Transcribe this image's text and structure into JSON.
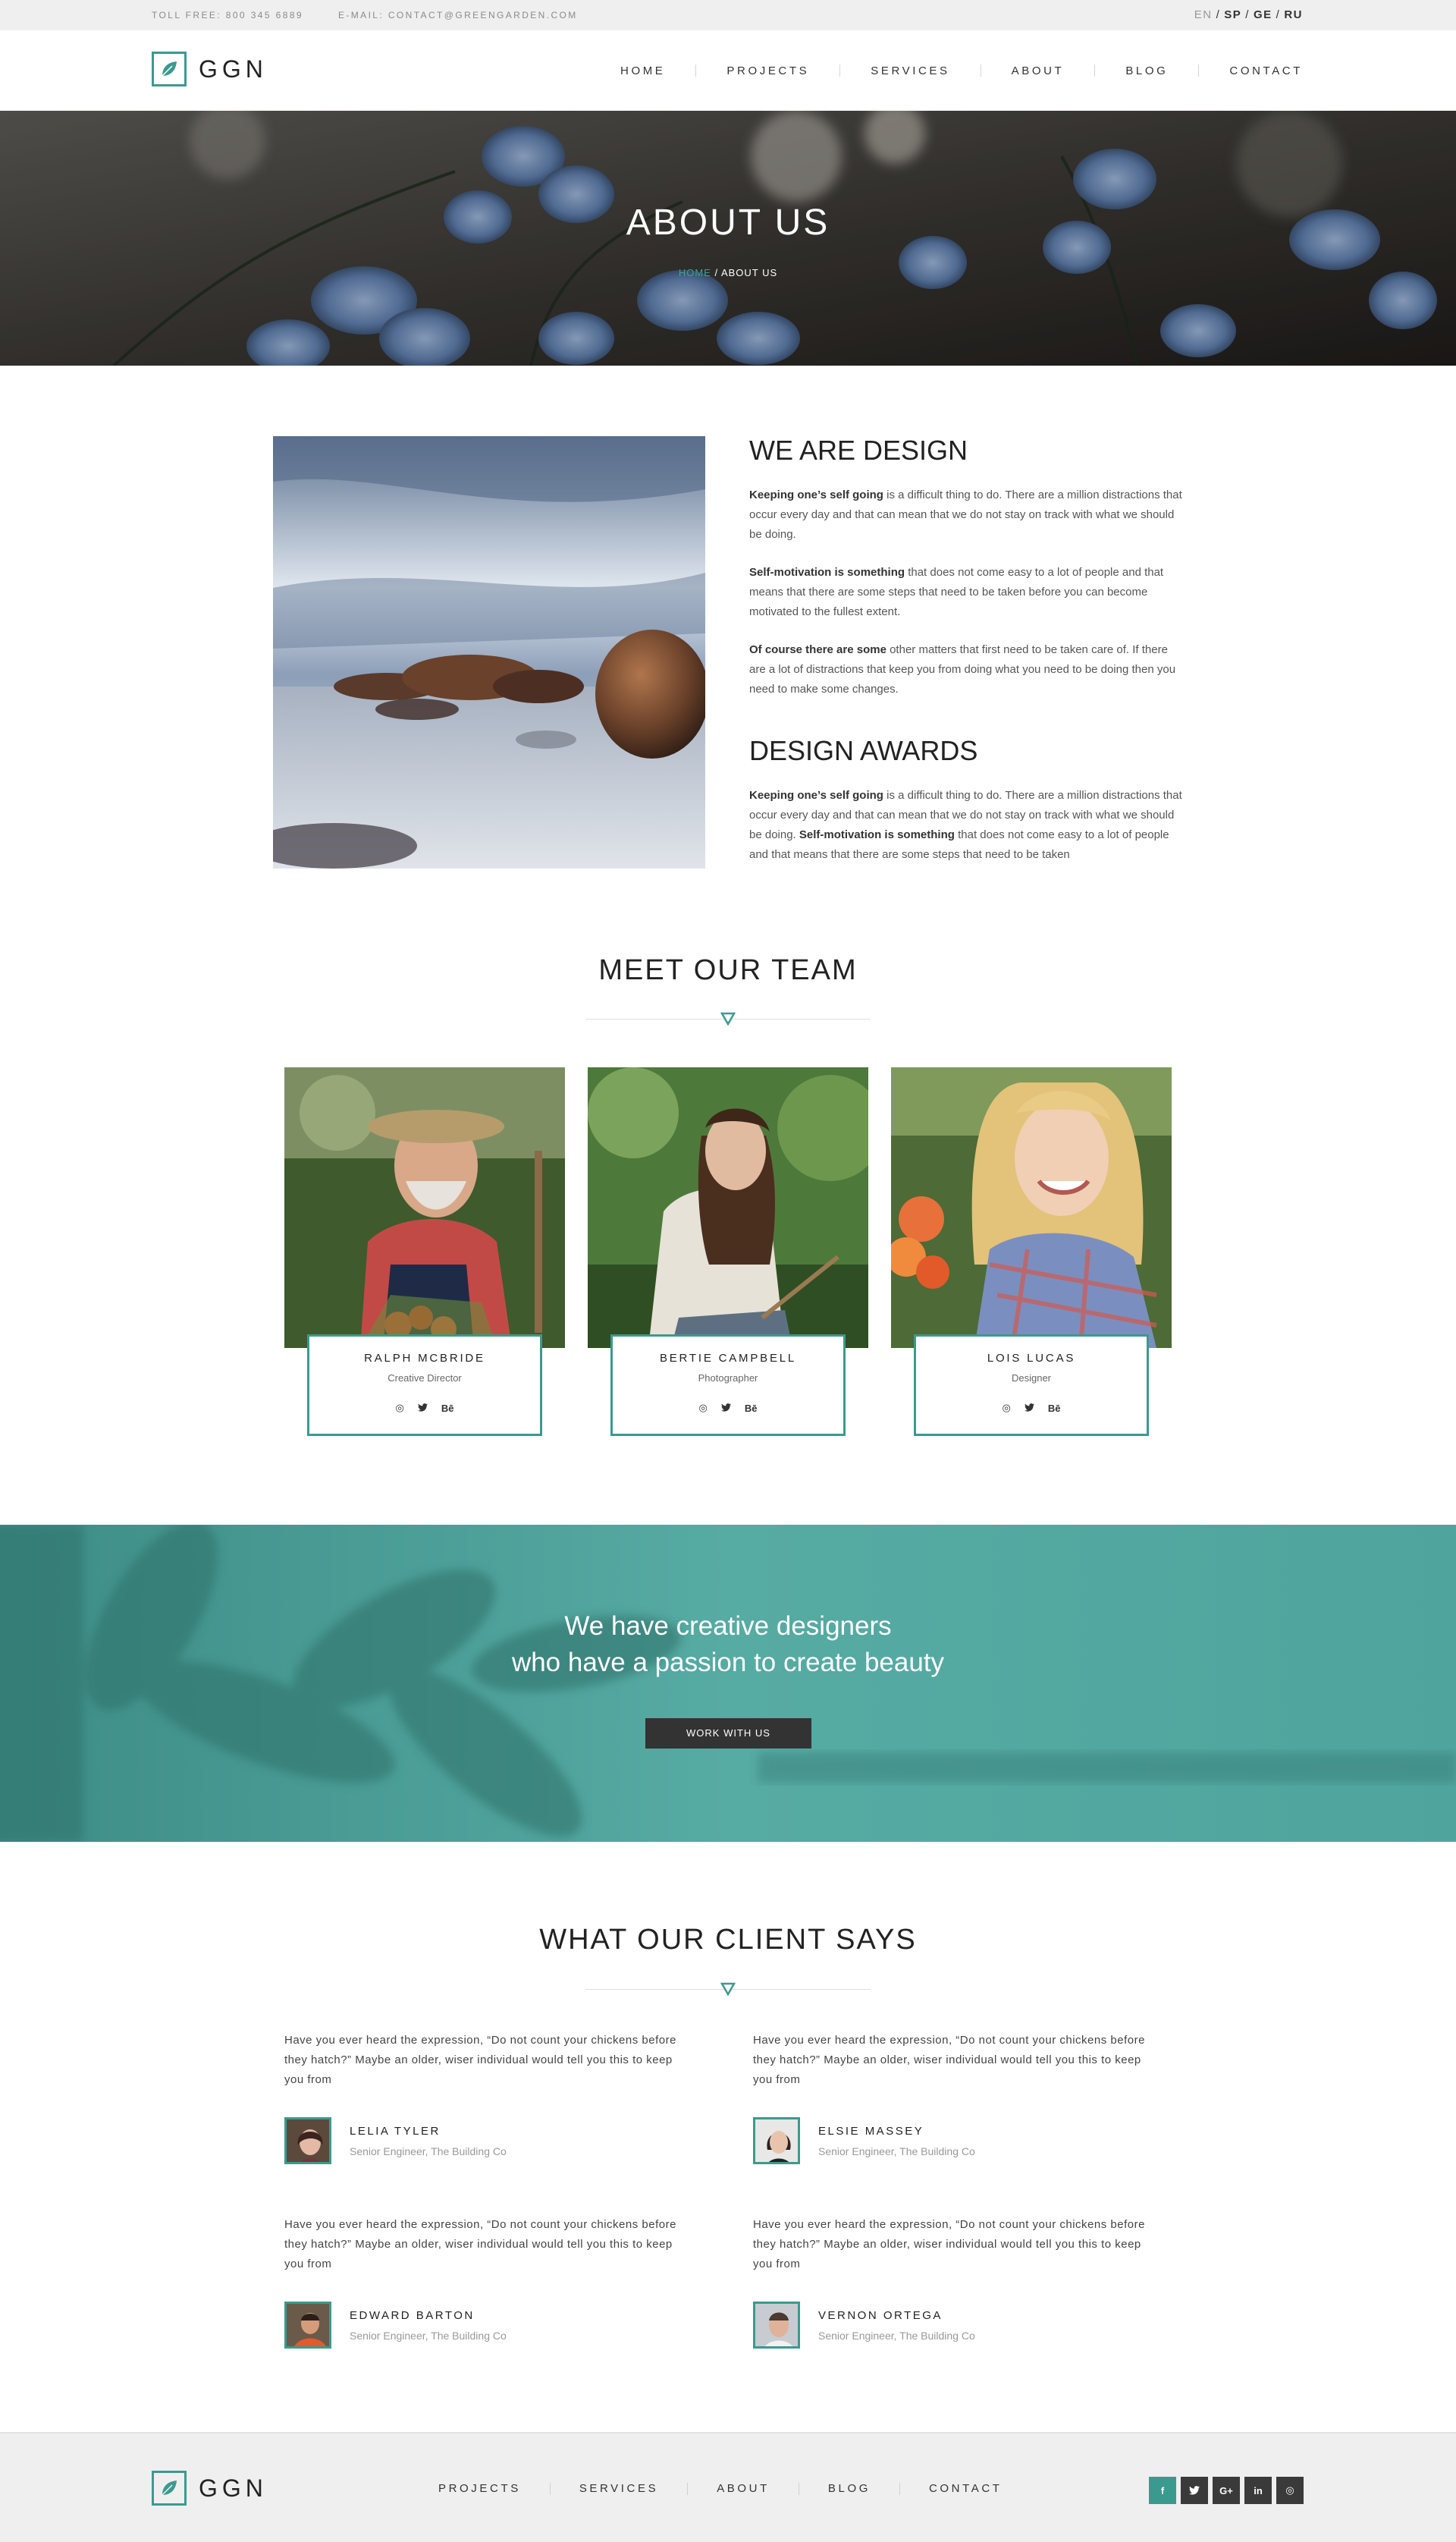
{
  "topbar": {
    "phone": "TOLL FREE: 800 345 6889",
    "email": "E-MAIL: CONTACT@GREENGARDEN.COM",
    "languages": [
      "EN",
      "SP",
      "GE",
      "RU"
    ],
    "lang_sep": "/"
  },
  "header": {
    "logo_text": "GGN",
    "nav": [
      "HOME",
      "PROJECTS",
      "SERVICES",
      "ABOUT",
      "BLOG",
      "CONTACT"
    ]
  },
  "hero": {
    "title": "ABOUT US",
    "breadcrumb_home": "HOME",
    "breadcrumb_current": "/ ABOUT US"
  },
  "about": {
    "design_title": "WE ARE DESIGN",
    "p1_bold": "Keeping one’s self going",
    "p1_rest": " is a difficult thing to do. There are a million distractions that occur every day and that can mean that we do not stay on track with what we should be doing.",
    "p2_bold": "Self-motivation is something",
    "p2_rest": " that does not come easy to a lot of people and that means that there are some steps that need to be taken before you can become motivated to the fullest extent.",
    "p3_bold": "Of course there are some",
    "p3_rest": " other matters that first need to be taken care of. If there are a lot of distractions that keep you from doing what you need to be doing then you need to make some changes.",
    "awards_title": "DESIGN AWARDS",
    "a1_bold": "Keeping one’s self going",
    "a1_rest": " is a difficult thing to do. There are a million distractions that occur every day and that can mean that we do not stay on track with what we should be doing. ",
    "a2_bold": "Self-motivation is something",
    "a2_rest": " that does not come easy to a lot of people and that means that there are some steps that need to be taken"
  },
  "team": {
    "title": "MEET OUR TEAM",
    "social": [
      "dribbble-icon",
      "twitter-icon",
      "Bē"
    ],
    "members": [
      {
        "name": "RALPH MCBRIDE",
        "role": "Creative Director"
      },
      {
        "name": "BERTIE CAMPBELL",
        "role": "Photographer"
      },
      {
        "name": "LOIS LUCAS",
        "role": "Designer"
      }
    ]
  },
  "cta": {
    "line1": "We have creative designers",
    "line2": "who have a passion to create beauty",
    "button": "WORK WITH US"
  },
  "testimonials": {
    "title": "WHAT OUR CLIENT SAYS",
    "items": [
      {
        "text": "Have you ever heard the expression, “Do not count your chickens before they hatch?” Maybe an older, wiser individual would tell you this to keep you from",
        "name": "LELIA TYLER",
        "role": "Senior Engineer, The Building Co"
      },
      {
        "text": "Have you ever heard the expression, “Do not count your chickens before they hatch?” Maybe an older, wiser individual would tell you this to keep you from",
        "name": "ELSIE MASSEY",
        "role": "Senior Engineer, The Building Co"
      },
      {
        "text": "Have you ever heard the expression, “Do not count your chickens before they hatch?” Maybe an older, wiser individual would tell you this to keep you from",
        "name": "EDWARD BARTON",
        "role": "Senior Engineer, The Building Co"
      },
      {
        "text": "Have you ever heard the expression, “Do not count your chickens before they hatch?” Maybe an older, wiser individual would tell you this to keep you from",
        "name": "VERNON ORTEGA",
        "role": "Senior Engineer, The Building Co"
      }
    ]
  },
  "footer": {
    "logo_text": "GGN",
    "nav": [
      "PROJECTS",
      "SERVICES",
      "ABOUT",
      "BLOG",
      "CONTACT"
    ],
    "social": [
      {
        "label": "f",
        "icon": "facebook-icon"
      },
      {
        "label": "t",
        "icon": "twitter-icon"
      },
      {
        "label": "G+",
        "icon": "google-plus-icon"
      },
      {
        "label": "in",
        "icon": "linkedin-icon"
      },
      {
        "label": "◎",
        "icon": "instagram-icon"
      }
    ]
  },
  "colors": {
    "accent": "#3b9a8f",
    "dark": "#333333",
    "light_bg": "#efefef"
  }
}
